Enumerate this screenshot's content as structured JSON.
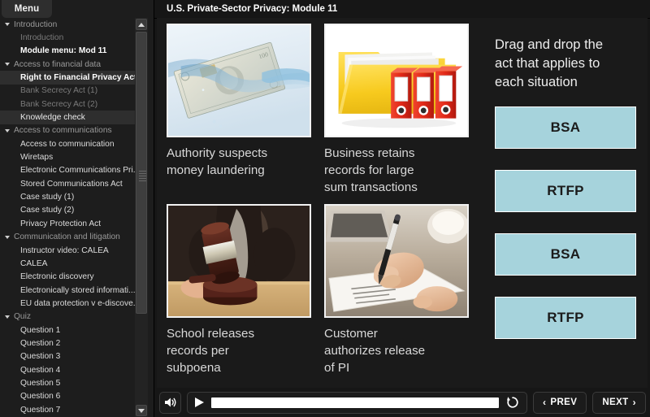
{
  "sidebar": {
    "tab_label": "Menu",
    "items": [
      {
        "label": "Introduction",
        "type": "group",
        "state": "normal"
      },
      {
        "label": "Introduction",
        "type": "leaf",
        "state": "dim"
      },
      {
        "label": "Module menu: Mod 11",
        "type": "leaf",
        "state": "current"
      },
      {
        "label": "Access to financial data",
        "type": "group",
        "state": "normal"
      },
      {
        "label": "Right to Financial Privacy Act",
        "type": "leaf",
        "state": "selected"
      },
      {
        "label": "Bank Secrecy Act (1)",
        "type": "leaf",
        "state": "dim"
      },
      {
        "label": "Bank Secrecy Act (2)",
        "type": "leaf",
        "state": "dim"
      },
      {
        "label": "Knowledge check",
        "type": "leaf",
        "state": "selected-soft"
      },
      {
        "label": "Access to communications",
        "type": "group",
        "state": "normal"
      },
      {
        "label": "Access to communication",
        "type": "leaf",
        "state": "normal"
      },
      {
        "label": "Wiretaps",
        "type": "leaf",
        "state": "normal"
      },
      {
        "label": "Electronic Communications Pri...",
        "type": "leaf",
        "state": "normal"
      },
      {
        "label": "Stored Communications Act",
        "type": "leaf",
        "state": "normal"
      },
      {
        "label": "Case study (1)",
        "type": "leaf",
        "state": "normal"
      },
      {
        "label": "Case study (2)",
        "type": "leaf",
        "state": "normal"
      },
      {
        "label": "Privacy Protection Act",
        "type": "leaf",
        "state": "normal"
      },
      {
        "label": "Communication and litigation",
        "type": "group",
        "state": "normal"
      },
      {
        "label": "Instructor video: CALEA",
        "type": "leaf",
        "state": "normal"
      },
      {
        "label": "CALEA",
        "type": "leaf",
        "state": "normal"
      },
      {
        "label": "Electronic discovery",
        "type": "leaf",
        "state": "normal"
      },
      {
        "label": "Electronically stored informati...",
        "type": "leaf",
        "state": "normal"
      },
      {
        "label": "EU data protection v e-discove...",
        "type": "leaf",
        "state": "normal"
      },
      {
        "label": "Quiz",
        "type": "group",
        "state": "normal"
      },
      {
        "label": "Question 1",
        "type": "leaf",
        "state": "normal"
      },
      {
        "label": "Question 2",
        "type": "leaf",
        "state": "normal"
      },
      {
        "label": "Question 3",
        "type": "leaf",
        "state": "normal"
      },
      {
        "label": "Question 4",
        "type": "leaf",
        "state": "normal"
      },
      {
        "label": "Question 5",
        "type": "leaf",
        "state": "normal"
      },
      {
        "label": "Question 6",
        "type": "leaf",
        "state": "normal"
      },
      {
        "label": "Question 7",
        "type": "leaf",
        "state": "normal"
      }
    ]
  },
  "header": {
    "title": "U.S. Private-Sector Privacy: Module 11"
  },
  "slide": {
    "cards": [
      {
        "caption": "Authority suspects\nmoney laundering",
        "image": "money-in-water-image"
      },
      {
        "caption": "Business retains\nrecords for large\nsum transactions",
        "image": "folder-binders-image"
      },
      {
        "caption": "School releases\nrecords per\nsubpoena",
        "image": "judge-gavel-image"
      },
      {
        "caption": "Customer\nauthorizes release\nof PI",
        "image": "signing-document-image"
      }
    ],
    "dragdrop": {
      "prompt": "Drag and drop the\nact that applies to\neach situation",
      "items": [
        "BSA",
        "RTFP",
        "BSA",
        "RTFP"
      ],
      "tile_color": "#a6d3dc"
    }
  },
  "player": {
    "volume_icon": "speaker-icon",
    "play_icon": "play-icon",
    "replay_icon": "replay-icon",
    "prev_label": "PREV",
    "next_label": "NEXT",
    "prev_chevron": "‹",
    "next_chevron": "›",
    "progress_percent": 0
  }
}
